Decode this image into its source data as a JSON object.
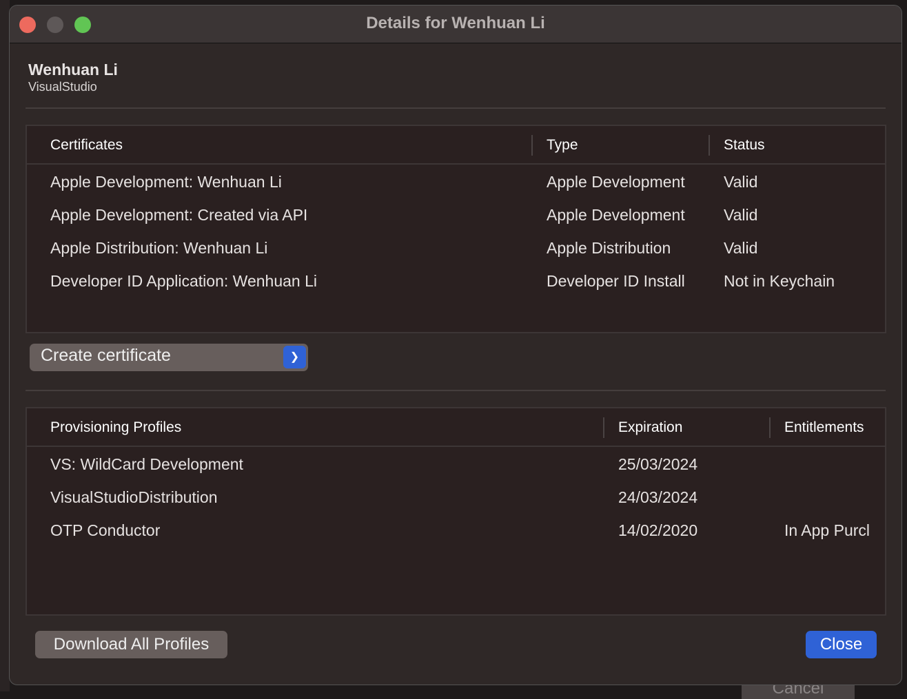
{
  "background": {
    "cancel_label": "Cancel"
  },
  "window": {
    "title": "Details for Wenhuan Li",
    "controls": {
      "close": "#ed6a5e",
      "minimize": "#5e5858",
      "zoom": "#61c554"
    }
  },
  "account": {
    "name": "Wenhuan Li",
    "team": "VisualStudio"
  },
  "certificates": {
    "headers": [
      "Certificates",
      "Type",
      "Status"
    ],
    "rows": [
      [
        "Apple Development: Wenhuan Li",
        "Apple Development",
        "Valid"
      ],
      [
        "Apple Development: Created via API",
        "Apple Development",
        "Valid"
      ],
      [
        "Apple Distribution: Wenhuan Li",
        "Apple Distribution",
        "Valid"
      ],
      [
        "Developer ID Application: Wenhuan Li",
        "Developer ID Install",
        "Not in Keychain"
      ]
    ]
  },
  "create_certificate": {
    "label": "Create certificate",
    "icon": "chevron-down-icon"
  },
  "profiles": {
    "headers": [
      "Provisioning Profiles",
      "Expiration",
      "Entitlements"
    ],
    "rows": [
      [
        "VS: WildCard Development",
        "25/03/2024",
        ""
      ],
      [
        "VisualStudioDistribution",
        "24/03/2024",
        ""
      ],
      [
        "OTP Conductor",
        "14/02/2020",
        "In App Purcl"
      ]
    ]
  },
  "buttons": {
    "download_all": "Download All Profiles",
    "close": "Close"
  },
  "colors": {
    "accent": "#2f62d6"
  }
}
